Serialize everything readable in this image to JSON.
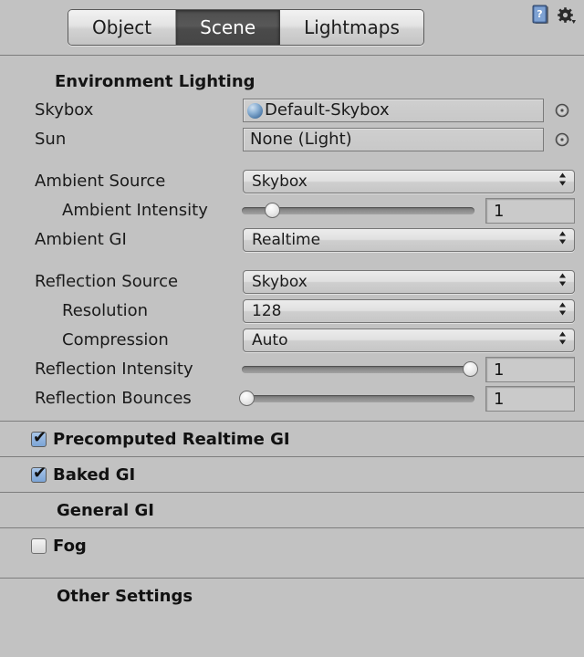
{
  "toolbar": {
    "tabs": [
      {
        "label": "Object",
        "active": false
      },
      {
        "label": "Scene",
        "active": true
      },
      {
        "label": "Lightmaps",
        "active": false
      }
    ],
    "help_icon": "help-book-icon",
    "settings_icon": "gear-dropdown-icon"
  },
  "environment_lighting": {
    "header": "Environment Lighting",
    "skybox": {
      "label": "Skybox",
      "value": "Default-Skybox",
      "icon": "material-sphere-icon",
      "picker_icon": "object-picker-icon"
    },
    "sun": {
      "label": "Sun",
      "value": "None (Light)",
      "picker_icon": "object-picker-icon"
    },
    "ambient_source": {
      "label": "Ambient Source",
      "value": "Skybox"
    },
    "ambient_intensity": {
      "label": "Ambient Intensity",
      "value": "1",
      "slider_percent": 13
    },
    "ambient_gi": {
      "label": "Ambient GI",
      "value": "Realtime"
    },
    "reflection_source": {
      "label": "Reflection Source",
      "value": "Skybox"
    },
    "resolution": {
      "label": "Resolution",
      "value": "128"
    },
    "compression": {
      "label": "Compression",
      "value": "Auto"
    },
    "reflection_intensity": {
      "label": "Reflection Intensity",
      "value": "1",
      "slider_percent": 98
    },
    "reflection_bounces": {
      "label": "Reflection Bounces",
      "value": "1",
      "slider_percent": 2
    }
  },
  "sections": {
    "precomputed_realtime_gi": {
      "label": "Precomputed Realtime GI",
      "checked": true,
      "check_glyph": "✔"
    },
    "baked_gi": {
      "label": "Baked GI",
      "checked": true,
      "check_glyph": "✔"
    },
    "general_gi": {
      "label": "General GI"
    },
    "fog": {
      "label": "Fog",
      "checked": false
    },
    "other_settings": {
      "label": "Other Settings"
    }
  },
  "colors": {
    "panel_bg": "#c2c2c2",
    "separator": "#7d7d7d",
    "active_tab_bg": "#4e4e4e",
    "checkbox_checked": "#7ba4d6",
    "text": "#1a1a1a"
  }
}
